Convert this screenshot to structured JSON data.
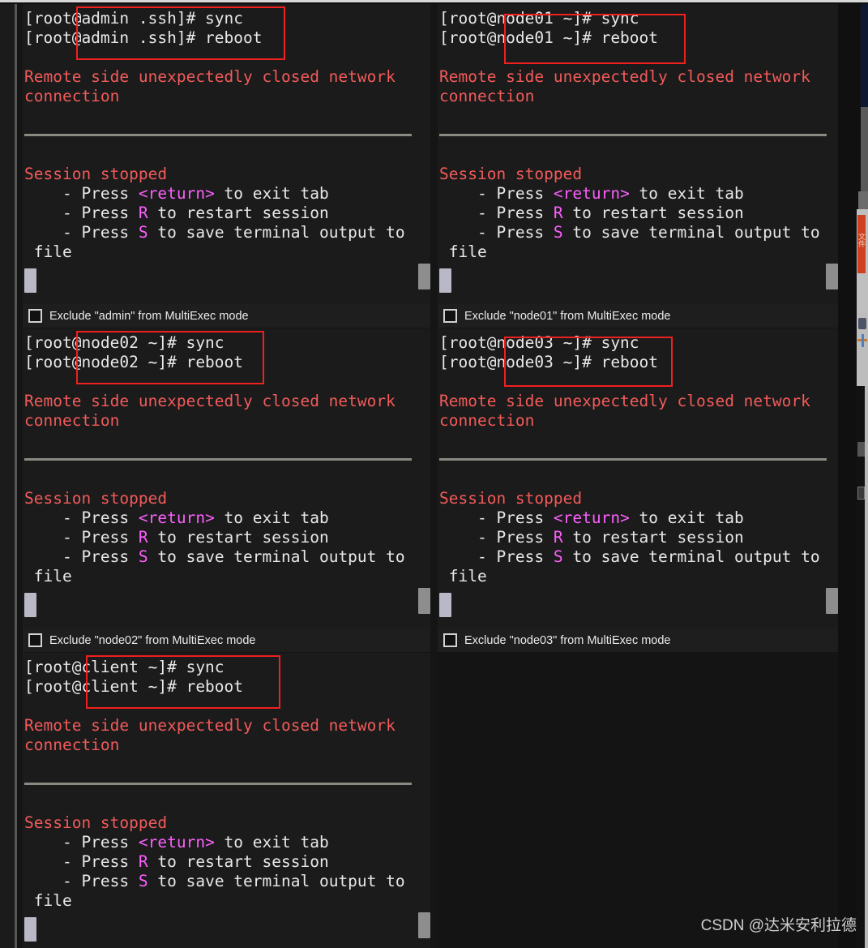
{
  "app": {
    "watermark": "CSDN @达米安利拉德"
  },
  "terminal_output": {
    "error_line1": "Remote side unexpectedly closed network",
    "error_line2": "connection",
    "session_stopped": "Session stopped",
    "hint_return_pre": "    - Press ",
    "hint_return_key": "<return>",
    "hint_return_post": " to exit tab",
    "hint_restart_pre": "    - Press ",
    "hint_restart_key": "R",
    "hint_restart_post": " to restart session",
    "hint_save_pre": "    - Press ",
    "hint_save_key": "S",
    "hint_save_post": " to save terminal output to",
    "hint_save_wrap": " file"
  },
  "panels": [
    {
      "host": "admin",
      "prompt_sync": "[root@admin .ssh]# sync",
      "prompt_reboot": "[root@admin .ssh]# reboot",
      "exclude_label": "Exclude \"admin\" from MultiExec mode",
      "exclude_checked": false
    },
    {
      "host": "node01",
      "prompt_sync": "[root@node01 ~]# sync",
      "prompt_reboot": "[root@node01 ~]# reboot",
      "exclude_label": "Exclude \"node01\" from MultiExec mode",
      "exclude_checked": false
    },
    {
      "host": "node02",
      "prompt_sync": "[root@node02 ~]# sync",
      "prompt_reboot": "[root@node02 ~]# reboot",
      "exclude_label": "Exclude \"node02\" from MultiExec mode",
      "exclude_checked": false
    },
    {
      "host": "node03",
      "prompt_sync": "[root@node03 ~]# sync",
      "prompt_reboot": "[root@node03 ~]# reboot",
      "exclude_label": "Exclude \"node03\" from MultiExec mode",
      "exclude_checked": false
    },
    {
      "host": "client",
      "prompt_sync": "[root@client ~]# sync",
      "prompt_reboot": "[root@client ~]# reboot",
      "exclude_label": "",
      "exclude_checked": false
    }
  ],
  "colors": {
    "terminal_bg": "#1b1b1b",
    "text": "#e8e8e8",
    "error_red": "#f25a5a",
    "key_magenta": "#fb5ffb",
    "annotation_red": "#ef2020",
    "separator": "#8a8a82"
  },
  "side_strip": {
    "tab_label": "文件"
  }
}
